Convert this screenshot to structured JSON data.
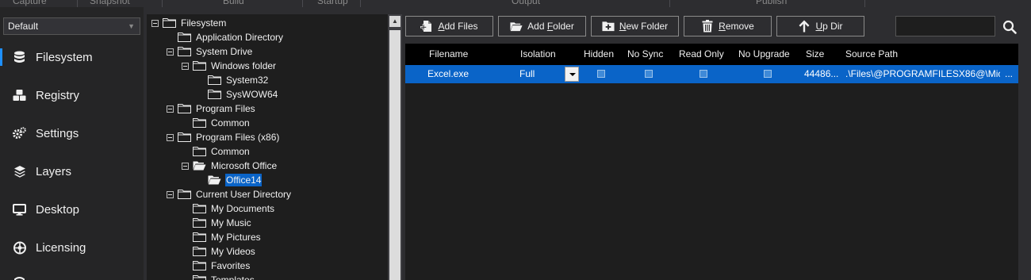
{
  "ribbon": {
    "tabs": [
      "Capture",
      "Snapshot",
      "Build",
      "Startup",
      "Output",
      "Publish"
    ]
  },
  "profile": {
    "value": "Default"
  },
  "nav": {
    "items": [
      {
        "label": "Filesystem",
        "icon": "database-icon",
        "active": true
      },
      {
        "label": "Registry",
        "icon": "cubes-icon",
        "active": false
      },
      {
        "label": "Settings",
        "icon": "gears-icon",
        "active": false
      },
      {
        "label": "Layers",
        "icon": "layers-icon",
        "active": false
      },
      {
        "label": "Desktop",
        "icon": "monitor-icon",
        "active": false
      },
      {
        "label": "Licensing",
        "icon": "shield-icon",
        "active": false
      }
    ]
  },
  "tree": {
    "items": [
      {
        "label": "Filesystem",
        "level": 0,
        "expander": true,
        "open": false,
        "selected": false
      },
      {
        "label": "Application Directory",
        "level": 1,
        "expander": false,
        "open": false,
        "selected": false
      },
      {
        "label": "System Drive",
        "level": 1,
        "expander": true,
        "open": false,
        "selected": false
      },
      {
        "label": "Windows folder",
        "level": 2,
        "expander": true,
        "open": false,
        "selected": false
      },
      {
        "label": "System32",
        "level": 3,
        "expander": false,
        "open": false,
        "selected": false
      },
      {
        "label": "SysWOW64",
        "level": 3,
        "expander": false,
        "open": false,
        "selected": false
      },
      {
        "label": "Program Files",
        "level": 1,
        "expander": true,
        "open": false,
        "selected": false
      },
      {
        "label": "Common",
        "level": 2,
        "expander": false,
        "open": false,
        "selected": false
      },
      {
        "label": "Program Files (x86)",
        "level": 1,
        "expander": true,
        "open": false,
        "selected": false
      },
      {
        "label": "Common",
        "level": 2,
        "expander": false,
        "open": false,
        "selected": false
      },
      {
        "label": "Microsoft Office",
        "level": 2,
        "expander": true,
        "open": true,
        "selected": false
      },
      {
        "label": "Office14",
        "level": 3,
        "expander": false,
        "open": true,
        "selected": true
      },
      {
        "label": "Current User Directory",
        "level": 1,
        "expander": true,
        "open": false,
        "selected": false
      },
      {
        "label": "My Documents",
        "level": 2,
        "expander": false,
        "open": false,
        "selected": false
      },
      {
        "label": "My Music",
        "level": 2,
        "expander": false,
        "open": false,
        "selected": false
      },
      {
        "label": "My Pictures",
        "level": 2,
        "expander": false,
        "open": false,
        "selected": false
      },
      {
        "label": "My Videos",
        "level": 2,
        "expander": false,
        "open": false,
        "selected": false
      },
      {
        "label": "Favorites",
        "level": 2,
        "expander": false,
        "open": false,
        "selected": false
      },
      {
        "label": "Templates",
        "level": 2,
        "expander": false,
        "open": false,
        "selected": false
      }
    ]
  },
  "toolbar": {
    "add_files": {
      "pre": "",
      "key": "A",
      "post": "dd Files"
    },
    "add_folder": {
      "pre": "Add ",
      "key": "F",
      "post": "older"
    },
    "new_folder": {
      "pre": "",
      "key": "N",
      "post": "ew Folder"
    },
    "remove": {
      "pre": "",
      "key": "R",
      "post": "emove"
    },
    "up_dir": {
      "pre": "",
      "key": "U",
      "post": "p Dir"
    },
    "search_value": ""
  },
  "grid": {
    "columns": [
      "Filename",
      "Isolation",
      "Hidden",
      "No Sync",
      "Read Only",
      "No Upgrade",
      "Size",
      "Source Path"
    ],
    "rows": [
      {
        "filename": "Excel.exe",
        "isolation": "Full",
        "size": "44486...",
        "source_path": ".\\Files\\@PROGRAMFILESX86@\\Mic...",
        "more": "..."
      }
    ]
  },
  "colors": {
    "accent": "#0a64c8",
    "nav_active_bar": "#1e90ff",
    "background": "#2d2d30",
    "panel": "#1e1e1e"
  }
}
